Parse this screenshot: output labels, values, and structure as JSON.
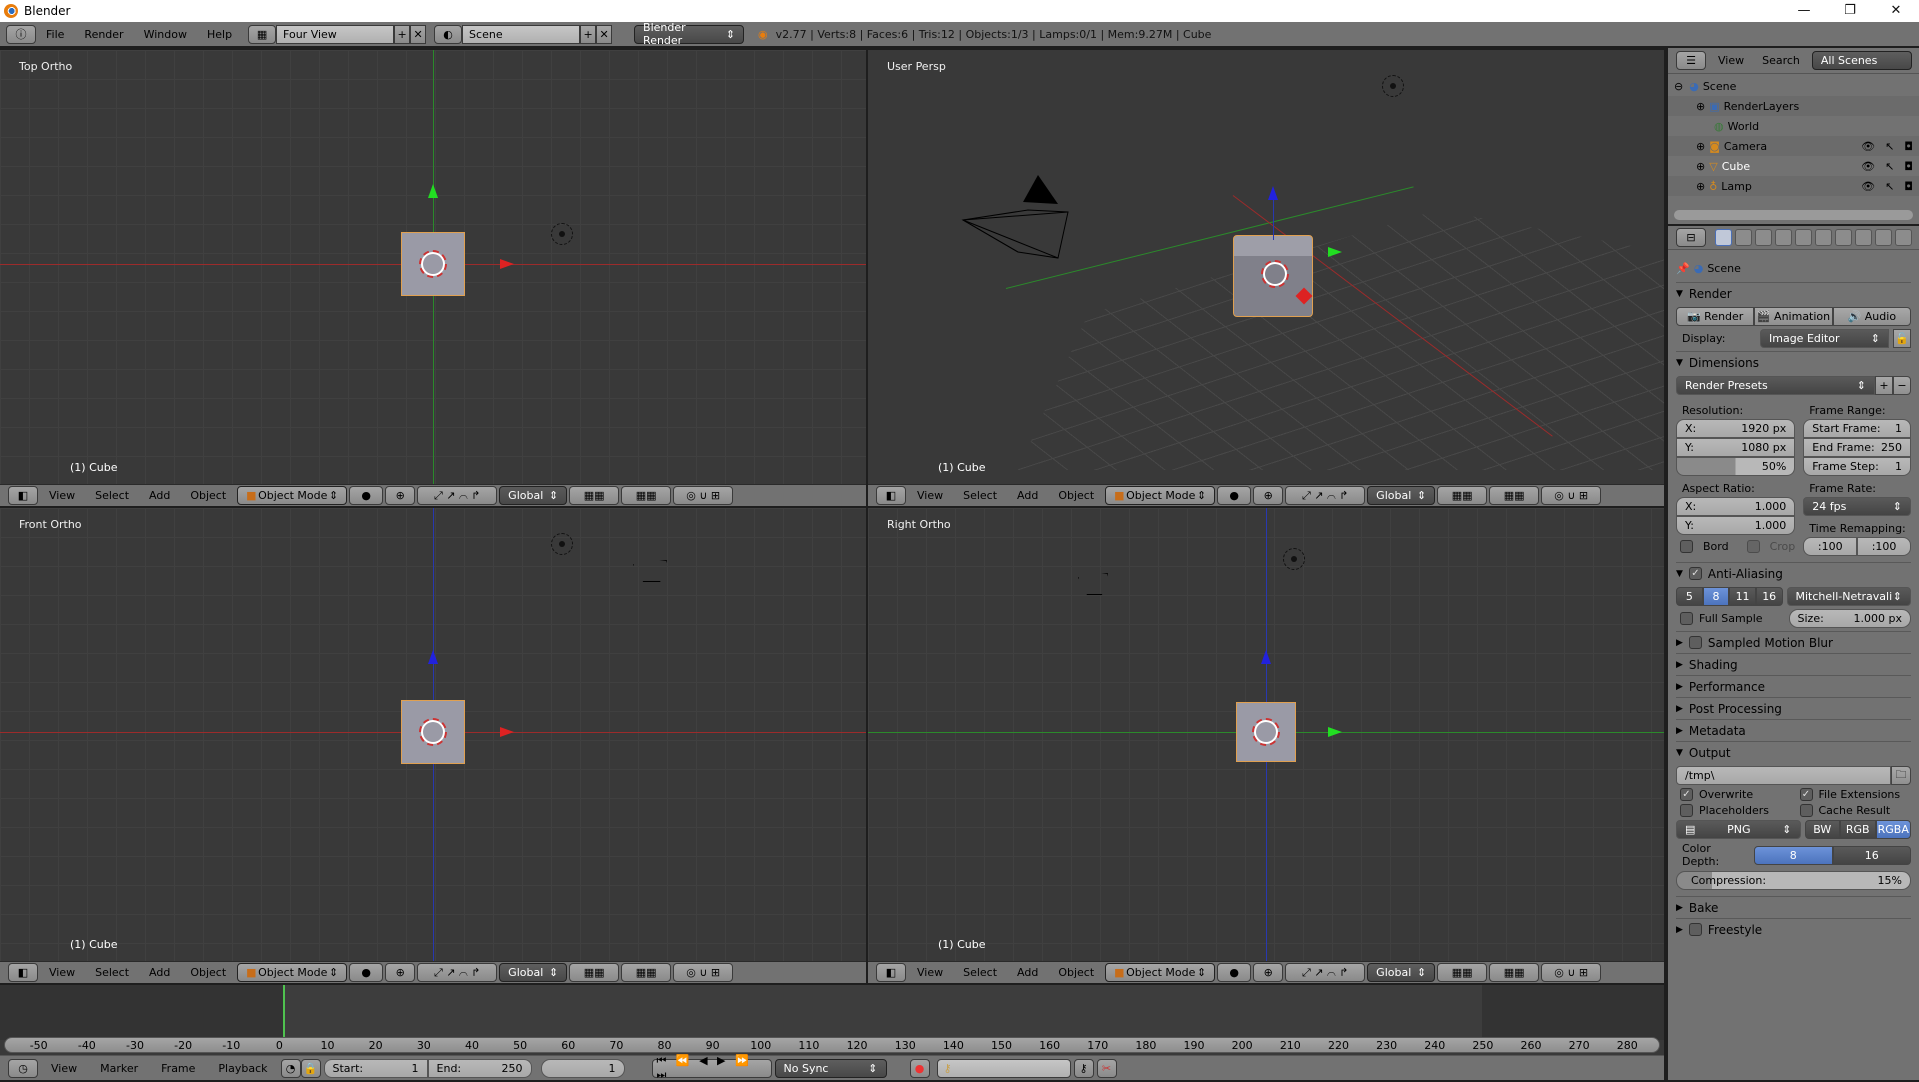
{
  "window": {
    "title": "Blender",
    "controls": [
      "—",
      "❐",
      "✕"
    ]
  },
  "topbar": {
    "menus": [
      "File",
      "Render",
      "Window",
      "Help"
    ],
    "layout": "Four View",
    "scene": "Scene",
    "engine": "Blender Render",
    "stats": "v2.77 | Verts:8 | Faces:6 | Tris:12 | Objects:1/3 | Lamps:0/1 | Mem:9.27M | Cube"
  },
  "viewports": [
    {
      "label": "Top Ortho",
      "object": "(1) Cube"
    },
    {
      "label": "User Persp",
      "object": "(1) Cube"
    },
    {
      "label": "Front Ortho",
      "object": "(1) Cube"
    },
    {
      "label": "Right Ortho",
      "object": "(1) Cube"
    }
  ],
  "viewport_header": {
    "menus": [
      "View",
      "Select",
      "Add",
      "Object"
    ],
    "mode": "Object Mode",
    "orientation": "Global"
  },
  "outliner": {
    "menus": [
      "View",
      "Search"
    ],
    "filter": "All Scenes",
    "items": [
      {
        "name": "Scene",
        "icon": "scene-icon"
      },
      {
        "name": "RenderLayers",
        "icon": "render-layers-icon"
      },
      {
        "name": "World",
        "icon": "world-icon"
      },
      {
        "name": "Camera",
        "icon": "camera-icon"
      },
      {
        "name": "Cube",
        "icon": "mesh-icon"
      },
      {
        "name": "Lamp",
        "icon": "lamp-icon"
      }
    ]
  },
  "properties": {
    "context": "Scene",
    "render": {
      "title": "Render",
      "buttons": [
        "Render",
        "Animation",
        "Audio"
      ],
      "display_label": "Display:",
      "display_value": "Image Editor"
    },
    "dimensions": {
      "title": "Dimensions",
      "presets": "Render Presets",
      "resolution_label": "Resolution:",
      "res_x": "1920 px",
      "res_y": "1080 px",
      "res_percent": "50%",
      "res_percent_value": 50,
      "frame_range_label": "Frame Range:",
      "start_frame": "1",
      "end_frame": "250",
      "frame_step": "1",
      "aspect_label": "Aspect Ratio:",
      "aspect_x": "1.000",
      "aspect_y": "1.000",
      "frame_rate_label": "Frame Rate:",
      "frame_rate": "24 fps",
      "time_remap_label": "Time Remapping:",
      "remap_old": ":100",
      "remap_new": ":100",
      "bord": "Bord",
      "crop": "Crop"
    },
    "anti_aliasing": {
      "title": "Anti-Aliasing",
      "enabled": true,
      "samples": [
        "5",
        "8",
        "11",
        "16"
      ],
      "selected_sample": "8",
      "filter": "Mitchell-Netravali",
      "full_sample": "Full Sample",
      "size_label": "Size:",
      "size_value": "1.000 px"
    },
    "collapsed": [
      "Sampled Motion Blur",
      "Shading",
      "Performance",
      "Post Processing",
      "Metadata"
    ],
    "output": {
      "title": "Output",
      "path": "/tmp\\",
      "overwrite": "Overwrite",
      "file_extensions": "File Extensions",
      "placeholders": "Placeholders",
      "cache_result": "Cache Result",
      "format": "PNG",
      "color_modes": [
        "BW",
        "RGB",
        "RGBA"
      ],
      "selected_color_mode": "RGBA",
      "color_depth_label": "Color Depth:",
      "color_depths": [
        "8",
        "16"
      ],
      "compression_label": "Compression:",
      "compression": "15%",
      "compression_value": 15
    },
    "bottom": [
      "Bake",
      "Freestyle"
    ]
  },
  "timeline": {
    "ticks": [
      "-50",
      "-40",
      "-30",
      "-20",
      "-10",
      "0",
      "10",
      "20",
      "30",
      "40",
      "50",
      "60",
      "70",
      "80",
      "90",
      "100",
      "110",
      "120",
      "130",
      "140",
      "150",
      "160",
      "170",
      "180",
      "190",
      "200",
      "210",
      "220",
      "230",
      "240",
      "250",
      "260",
      "270",
      "280"
    ],
    "current_frame": 1,
    "menus": [
      "View",
      "Marker",
      "Frame",
      "Playback"
    ],
    "start_label": "Start:",
    "start": "1",
    "end_label": "End:",
    "end": "250",
    "current": "1",
    "sync": "No Sync"
  }
}
